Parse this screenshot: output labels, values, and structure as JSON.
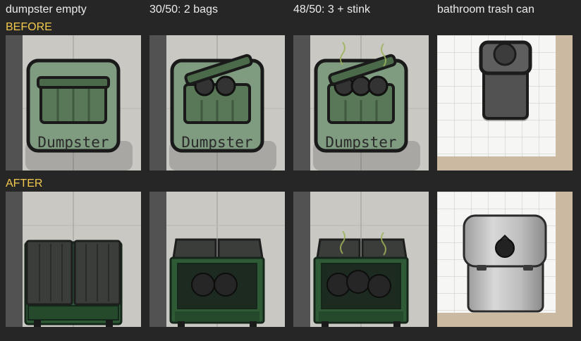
{
  "columns": [
    {
      "label": "dumpster empty"
    },
    {
      "label": "30/50: 2 bags"
    },
    {
      "label": "48/50: 3 + stink"
    },
    {
      "label": "bathroom trash can"
    }
  ],
  "rows": {
    "before": {
      "label": "BEFORE"
    },
    "after": {
      "label": "AFTER"
    }
  },
  "tiles": {
    "dumpster_sign_text": "Dumpster",
    "before_bag_counts": [
      0,
      2,
      3
    ],
    "after_bag_counts": [
      0,
      2,
      3
    ],
    "stink": [
      false,
      false,
      true
    ]
  },
  "colors": {
    "background": "#262626",
    "label_text": "#ececec",
    "row_label": "#f2c94c",
    "icon_green": "#6b8c6b",
    "dumpster_green": "#2f5a36",
    "tile_floor": "#f4f4f2"
  },
  "icons": [
    "dumpster-icon",
    "trash-bag-icon",
    "stink-lines-icon",
    "trash-can-icon",
    "steel-bin-icon"
  ]
}
